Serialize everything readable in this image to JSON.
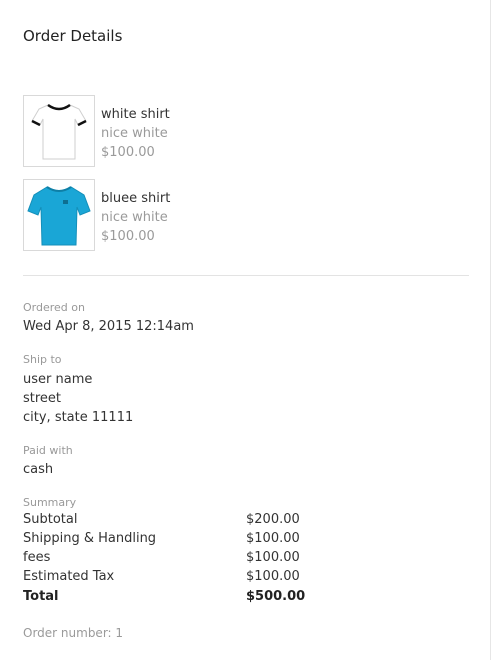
{
  "header": {
    "title": "Order Details"
  },
  "products": [
    {
      "name": "white shirt",
      "description": "nice white",
      "price": "$100.00",
      "image_color": "#ffffff"
    },
    {
      "name": "bluee shirt",
      "description": "nice white",
      "price": "$100.00",
      "image_color": "#1aa6d6"
    }
  ],
  "ordered": {
    "label": "Ordered on",
    "value": "Wed Apr 8, 2015 12:14am"
  },
  "ship": {
    "label": "Ship to",
    "lines": [
      "user name",
      "street",
      "city, state 11111"
    ]
  },
  "payment": {
    "label": "Paid with",
    "value": "cash"
  },
  "summary": {
    "label": "Summary",
    "rows": [
      {
        "label": "Subtotal",
        "value": "$200.00"
      },
      {
        "label": "Shipping & Handling",
        "value": "$100.00"
      },
      {
        "label": "fees",
        "value": "$100.00"
      },
      {
        "label": "Estimated Tax",
        "value": "$100.00"
      }
    ],
    "total": {
      "label": "Total",
      "value": "$500.00"
    }
  },
  "order_number": "Order number: 1"
}
